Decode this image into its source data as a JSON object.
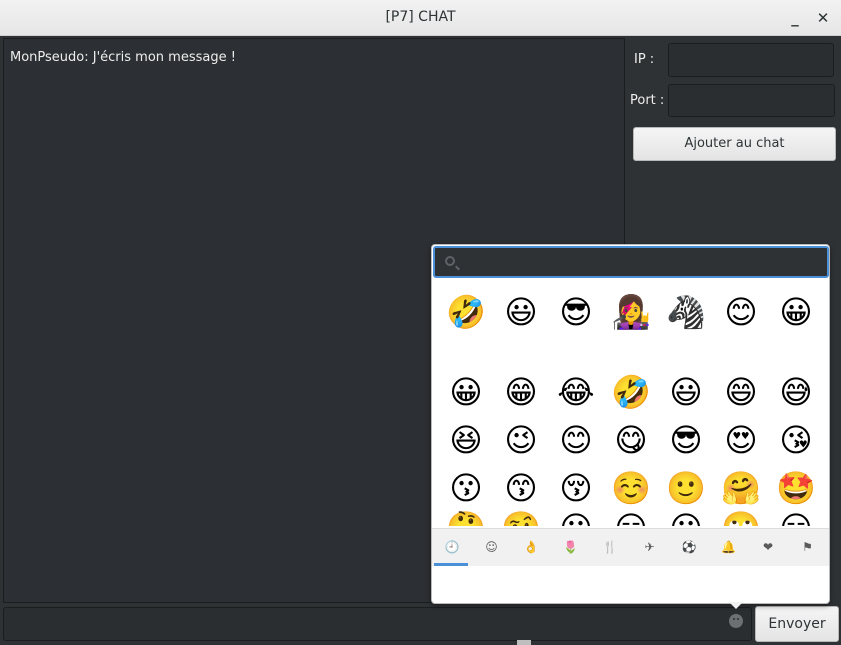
{
  "window": {
    "title": "[P7] CHAT",
    "minimize_label": "_",
    "close_label": "✕"
  },
  "chat": {
    "messages": [
      "MonPseudo: J'écris mon message !"
    ]
  },
  "connection": {
    "ip_label": "IP :",
    "ip_value": "",
    "port_label": "Port :",
    "port_value": "",
    "add_button": "Ajouter au chat"
  },
  "composer": {
    "input_value": "",
    "send_button": "Envoyer",
    "emoji_trigger_icon": "smiley-icon"
  },
  "emoji_picker": {
    "search_placeholder": "",
    "recent_row": [
      "🤣",
      "😃",
      "😎",
      "👩‍🎤",
      "🦓",
      "😊",
      "😀"
    ],
    "rows": [
      [
        "😀",
        "😁",
        "😂",
        "🤣",
        "😃",
        "😄",
        "😅"
      ],
      [
        "😆",
        "😉",
        "😊",
        "😋",
        "😎",
        "😍",
        "😘"
      ],
      [
        "😗",
        "😙",
        "😚",
        "☺️",
        "🙂",
        "🤗",
        "🤩"
      ],
      [
        "🤔",
        "🤨",
        "😐",
        "😑",
        "😶",
        "🙄",
        "😏"
      ]
    ],
    "categories": [
      {
        "icon": "recent-clock-icon",
        "glyph": "🕘"
      },
      {
        "icon": "smileys-icon",
        "glyph": "☺"
      },
      {
        "icon": "body-hand-icon",
        "glyph": "👌"
      },
      {
        "icon": "nature-flower-icon",
        "glyph": "🌷"
      },
      {
        "icon": "food-cutlery-icon",
        "glyph": "🍴"
      },
      {
        "icon": "travel-plane-icon",
        "glyph": "✈"
      },
      {
        "icon": "activities-icon",
        "glyph": "⚽"
      },
      {
        "icon": "objects-bell-icon",
        "glyph": "🔔"
      },
      {
        "icon": "symbols-heart-icon",
        "glyph": "❤"
      },
      {
        "icon": "flags-icon",
        "glyph": "⚑"
      }
    ],
    "active_category": 0
  }
}
